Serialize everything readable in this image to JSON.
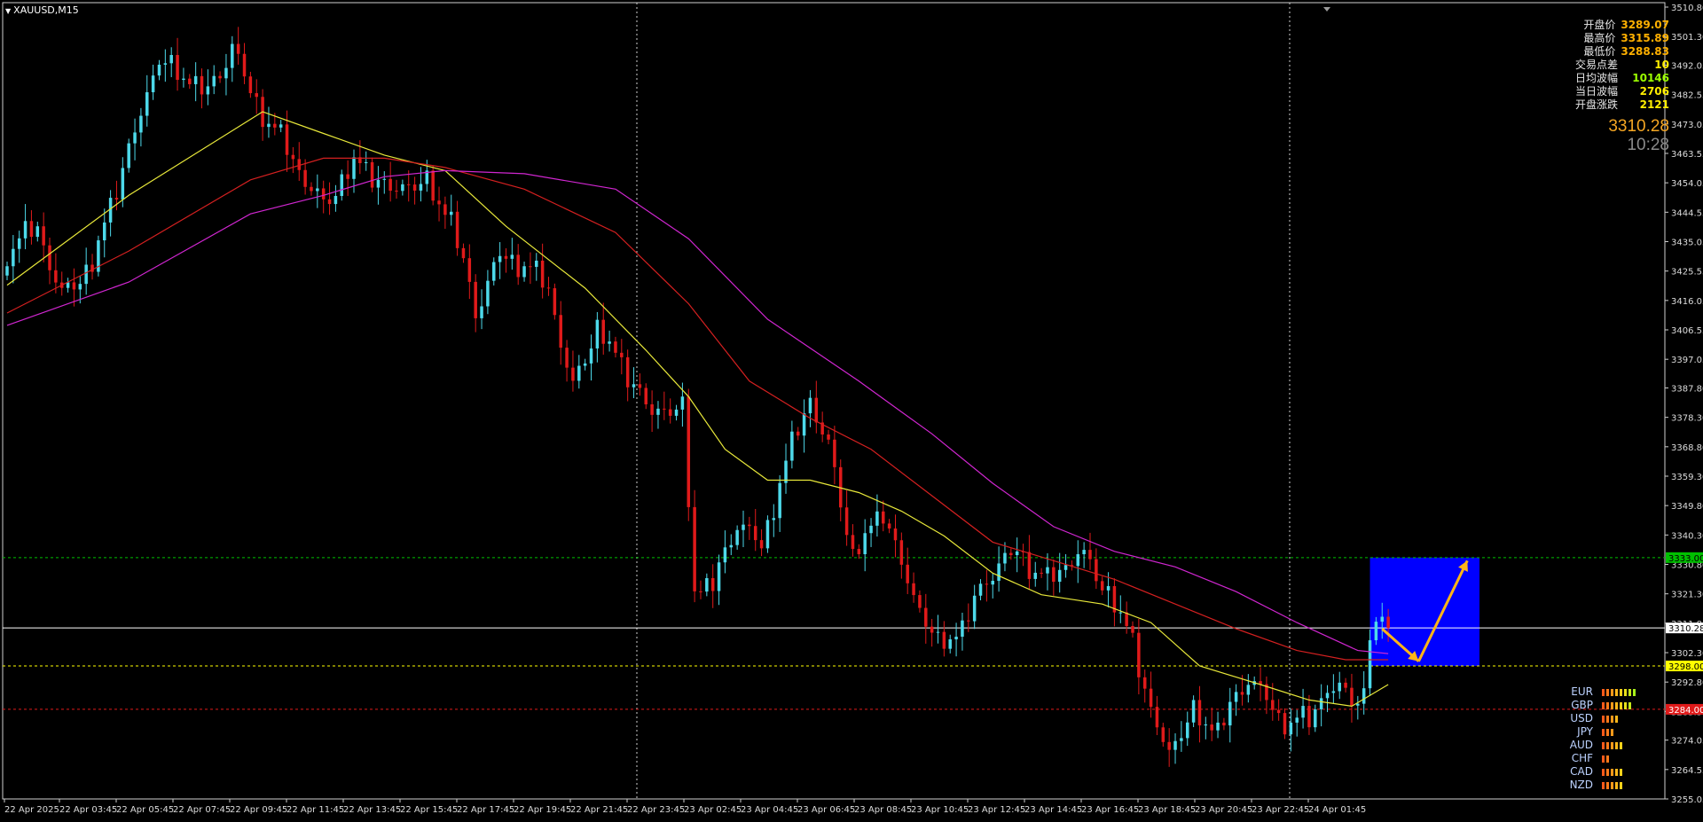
{
  "window": {
    "symbol_label": "XAUUSD,M15"
  },
  "info_panel": {
    "rows": [
      {
        "label": "开盘价",
        "value": "3289.07",
        "color": "#ffb000"
      },
      {
        "label": "最高价",
        "value": "3315.89",
        "color": "#ffb000"
      },
      {
        "label": "最低价",
        "value": "3288.83",
        "color": "#ffb000"
      },
      {
        "label": "交易点差",
        "value": "10",
        "color": "#ffee00"
      },
      {
        "label": "日均波幅",
        "value": "10146",
        "color": "#9cff00"
      },
      {
        "label": "当日波幅",
        "value": "2706",
        "color": "#ffee00"
      },
      {
        "label": "开盘涨跌",
        "value": "2121",
        "color": "#ffee00"
      }
    ]
  },
  "current_price": "3310.28",
  "candle_timer": "10:28",
  "colors": {
    "bull": "#4dd9ea",
    "bear": "#e01a1a",
    "ma_fast": "#e8e83a",
    "ma_mid": "#d42020",
    "ma_slow": "#d026d0",
    "zone": "#0000ff",
    "arrow": "#ffb418",
    "grid_line": "#ffffff"
  },
  "chart_data": {
    "type": "candlestick",
    "symbol": "XAUUSD",
    "timeframe": "M15",
    "ylim": [
      3255.05,
      3510.8
    ],
    "y_ticks": [
      "3510.80",
      "3501.30",
      "3492.05",
      "3482.55",
      "3473.05",
      "3463.55",
      "3454.05",
      "3444.55",
      "3435.05",
      "3425.55",
      "3416.05",
      "3406.55",
      "3397.05",
      "3387.80",
      "3378.30",
      "3368.80",
      "3359.30",
      "3349.80",
      "3340.30",
      "3330.80",
      "3321.30",
      "3311.80",
      "3302.30",
      "3292.80",
      "3283.30",
      "3274.05",
      "3264.55",
      "3255.05"
    ],
    "x_ticks": [
      "22 Apr 2025",
      "22 Apr 03:45",
      "22 Apr 05:45",
      "22 Apr 07:45",
      "22 Apr 09:45",
      "22 Apr 11:45",
      "22 Apr 13:45",
      "22 Apr 15:45",
      "22 Apr 17:45",
      "22 Apr 19:45",
      "22 Apr 21:45",
      "22 Apr 23:45",
      "23 Apr 02:45",
      "23 Apr 04:45",
      "23 Apr 06:45",
      "23 Apr 08:45",
      "23 Apr 10:45",
      "23 Apr 12:45",
      "23 Apr 14:45",
      "23 Apr 16:45",
      "23 Apr 18:45",
      "23 Apr 20:45",
      "23 Apr 22:45",
      "24 Apr 01:45"
    ],
    "price_levels": [
      {
        "price": 3333.0,
        "label": "3333.00",
        "color": "#00c000",
        "style": "dotted"
      },
      {
        "price": 3310.28,
        "label": "3310.28",
        "color": "#ffffff",
        "style": "solid"
      },
      {
        "price": 3298.0,
        "label": "3298.00",
        "color": "#ffff00",
        "style": "dotted"
      },
      {
        "price": 3284.0,
        "label": "3284.00",
        "color": "#e01a1a",
        "style": "dotted"
      }
    ],
    "period_separators": [
      "22 Apr 23:00",
      "24 Apr 01:00"
    ],
    "anchors": [
      {
        "t": 0,
        "p": 3432
      },
      {
        "t": 5,
        "p": 3440
      },
      {
        "t": 9,
        "p": 3417
      },
      {
        "t": 14,
        "p": 3428
      },
      {
        "t": 20,
        "p": 3465
      },
      {
        "t": 25,
        "p": 3494
      },
      {
        "t": 28,
        "p": 3490
      },
      {
        "t": 33,
        "p": 3483
      },
      {
        "t": 37,
        "p": 3498
      },
      {
        "t": 40,
        "p": 3483
      },
      {
        "t": 45,
        "p": 3468
      },
      {
        "t": 52,
        "p": 3446
      },
      {
        "t": 57,
        "p": 3461
      },
      {
        "t": 63,
        "p": 3452
      },
      {
        "t": 69,
        "p": 3454
      },
      {
        "t": 73,
        "p": 3442
      },
      {
        "t": 77,
        "p": 3413
      },
      {
        "t": 81,
        "p": 3430
      },
      {
        "t": 85,
        "p": 3428
      },
      {
        "t": 89,
        "p": 3420
      },
      {
        "t": 93,
        "p": 3387
      },
      {
        "t": 97,
        "p": 3408
      },
      {
        "t": 101,
        "p": 3395
      },
      {
        "t": 106,
        "p": 3380
      },
      {
        "t": 111,
        "p": 3381
      },
      {
        "t": 113,
        "p": 3323
      },
      {
        "t": 116,
        "p": 3324
      },
      {
        "t": 120,
        "p": 3345
      },
      {
        "t": 124,
        "p": 3336
      },
      {
        "t": 127,
        "p": 3358
      },
      {
        "t": 132,
        "p": 3385
      },
      {
        "t": 135,
        "p": 3368
      },
      {
        "t": 139,
        "p": 3334
      },
      {
        "t": 144,
        "p": 3348
      },
      {
        "t": 149,
        "p": 3320
      },
      {
        "t": 153,
        "p": 3305
      },
      {
        "t": 157,
        "p": 3310
      },
      {
        "t": 161,
        "p": 3327
      },
      {
        "t": 166,
        "p": 3335
      },
      {
        "t": 171,
        "p": 3325
      },
      {
        "t": 176,
        "p": 3335
      },
      {
        "t": 181,
        "p": 3322
      },
      {
        "t": 185,
        "p": 3306
      },
      {
        "t": 188,
        "p": 3283
      },
      {
        "t": 191,
        "p": 3270
      },
      {
        "t": 195,
        "p": 3283
      },
      {
        "t": 199,
        "p": 3277
      },
      {
        "t": 204,
        "p": 3295
      },
      {
        "t": 209,
        "p": 3281
      },
      {
        "t": 214,
        "p": 3280
      },
      {
        "t": 217,
        "p": 3292
      },
      {
        "t": 221,
        "p": 3287
      },
      {
        "t": 223,
        "p": 3289
      },
      {
        "t": 224,
        "p": 3309
      },
      {
        "t": 226,
        "p": 3313
      },
      {
        "t": 227,
        "p": 3310.28
      }
    ],
    "moving_averages": [
      {
        "name": "MA fast",
        "color": "#e8e83a",
        "points": [
          [
            0,
            3421
          ],
          [
            20,
            3450
          ],
          [
            42,
            3477
          ],
          [
            52,
            3470
          ],
          [
            62,
            3463
          ],
          [
            72,
            3458
          ],
          [
            82,
            3440
          ],
          [
            95,
            3420
          ],
          [
            105,
            3400
          ],
          [
            112,
            3385
          ],
          [
            118,
            3368
          ],
          [
            125,
            3358
          ],
          [
            132,
            3358
          ],
          [
            140,
            3354
          ],
          [
            147,
            3348
          ],
          [
            154,
            3340
          ],
          [
            162,
            3328
          ],
          [
            170,
            3321
          ],
          [
            180,
            3318
          ],
          [
            188,
            3312
          ],
          [
            196,
            3298
          ],
          [
            206,
            3292
          ],
          [
            214,
            3287
          ],
          [
            221,
            3285
          ],
          [
            227,
            3292
          ]
        ]
      },
      {
        "name": "MA mid",
        "color": "#d42020",
        "points": [
          [
            0,
            3412
          ],
          [
            20,
            3432
          ],
          [
            40,
            3455
          ],
          [
            52,
            3462
          ],
          [
            62,
            3462
          ],
          [
            72,
            3459
          ],
          [
            85,
            3452
          ],
          [
            100,
            3438
          ],
          [
            112,
            3415
          ],
          [
            122,
            3390
          ],
          [
            132,
            3378
          ],
          [
            142,
            3368
          ],
          [
            152,
            3353
          ],
          [
            162,
            3338
          ],
          [
            172,
            3332
          ],
          [
            182,
            3326
          ],
          [
            192,
            3318
          ],
          [
            202,
            3310
          ],
          [
            212,
            3303
          ],
          [
            220,
            3300
          ],
          [
            227,
            3300
          ]
        ]
      },
      {
        "name": "MA slow",
        "color": "#d026d0",
        "points": [
          [
            0,
            3408
          ],
          [
            20,
            3422
          ],
          [
            40,
            3444
          ],
          [
            52,
            3450
          ],
          [
            62,
            3456
          ],
          [
            72,
            3458
          ],
          [
            85,
            3457
          ],
          [
            100,
            3452
          ],
          [
            112,
            3436
          ],
          [
            125,
            3410
          ],
          [
            140,
            3390
          ],
          [
            152,
            3373
          ],
          [
            162,
            3357
          ],
          [
            172,
            3343
          ],
          [
            182,
            3335
          ],
          [
            192,
            3330
          ],
          [
            202,
            3322
          ],
          [
            212,
            3312
          ],
          [
            222,
            3303
          ],
          [
            227,
            3302
          ]
        ]
      }
    ],
    "target_zone": {
      "from_time_index": 224,
      "to_time_index": 242,
      "price_low": 3298.0,
      "price_high": 3333.0
    },
    "forecast_arrows": [
      {
        "from": [
          226,
          3310
        ],
        "to": [
          232,
          3299.5
        ]
      },
      {
        "from": [
          232,
          3299.5
        ],
        "to": [
          240,
          3332
        ]
      }
    ]
  },
  "currency_strength": [
    {
      "currency": "EUR",
      "bars": [
        "#ff5a1a",
        "#ff7a1a",
        "#ff9a1a",
        "#ffb81a",
        "#ffd21a",
        "#e8e01a",
        "#c8e81a",
        "#a8f01a"
      ]
    },
    {
      "currency": "GBP",
      "bars": [
        "#ff5a1a",
        "#ff7a1a",
        "#ff9a1a",
        "#ffb81a",
        "#ffd21a",
        "#e8e01a",
        "#c8e81a"
      ]
    },
    {
      "currency": "USD",
      "bars": [
        "#ff5a1a",
        "#ff7a1a",
        "#ff9a1a",
        "#ffb81a"
      ]
    },
    {
      "currency": "JPY",
      "bars": [
        "#ff5a1a",
        "#ff7a1a",
        "#ff9a1a"
      ]
    },
    {
      "currency": "AUD",
      "bars": [
        "#ff5a1a",
        "#ff7a1a",
        "#ff9a1a",
        "#ffb81a",
        "#ffd21a"
      ]
    },
    {
      "currency": "CHF",
      "bars": [
        "#ff5a1a",
        "#ff7a1a"
      ]
    },
    {
      "currency": "CAD",
      "bars": [
        "#ff5a1a",
        "#ff7a1a",
        "#ff9a1a",
        "#ffb81a",
        "#ffd21a"
      ]
    },
    {
      "currency": "NZD",
      "bars": [
        "#ff5a1a",
        "#ff7a1a",
        "#ff9a1a",
        "#ffb81a",
        "#ffd21a"
      ]
    }
  ]
}
